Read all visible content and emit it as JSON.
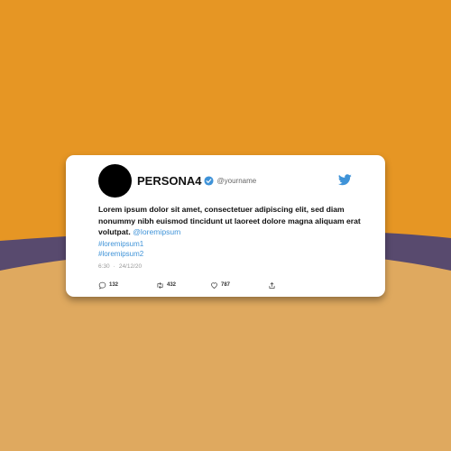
{
  "colors": {
    "background": "#E69624",
    "wave_purple": "#584A6E",
    "wave_sand": "#DFA95F",
    "card": "#FFFFFF",
    "accent_blue": "#3F93D8"
  },
  "tweet": {
    "display_name": "PERSONA4",
    "handle": "@yourname",
    "text": "Lorem ipsum dolor sit amet, consectetuer adipiscing elit, sed diam nonummy nibh euismod tincidunt ut laoreet dolore magna aliquam erat volutpat.",
    "mention": "@loremipsum",
    "hashtags": [
      "#loremipsum1",
      "#loremipsum2"
    ],
    "time": "6:30",
    "separator": "·",
    "date": "24/12/20",
    "replies": "132",
    "retweets": "432",
    "likes": "787"
  },
  "icons": {
    "logo": "twitter-bird-icon",
    "verified": "verified-badge-icon",
    "reply": "reply-icon",
    "retweet": "retweet-icon",
    "like": "heart-icon",
    "share": "share-icon"
  }
}
